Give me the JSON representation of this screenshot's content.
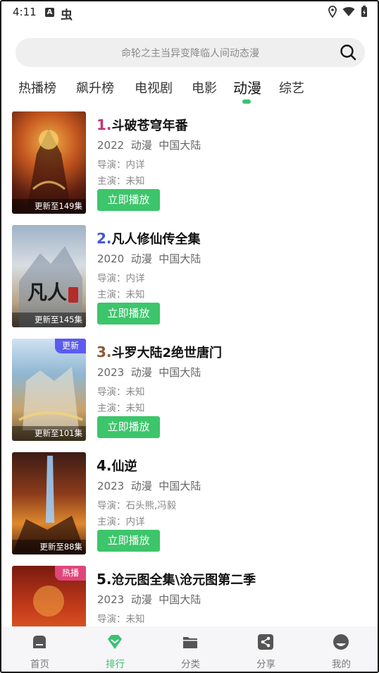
{
  "status_bar": {
    "time": "4:11",
    "a_glyph": "A",
    "bug_glyph": "虫"
  },
  "search": {
    "placeholder": "命轮之主当异变降临人间动态漫"
  },
  "tabs": [
    {
      "label": "热播榜"
    },
    {
      "label": "飙升榜"
    },
    {
      "label": "电视剧"
    },
    {
      "label": "电影"
    },
    {
      "label": "动漫",
      "active": true
    },
    {
      "label": "综艺"
    }
  ],
  "items": [
    {
      "rank": "1.",
      "rank_color": "#c2367a",
      "title": "斗破苍穹年番",
      "year": "2022",
      "type": "动漫",
      "region": "中国大陆",
      "director": "导演：内详",
      "actor": "主演：未知",
      "episodes": "更新至149集",
      "badge": "",
      "play_label": "立即播放"
    },
    {
      "rank": "2.",
      "rank_color": "#4457d6",
      "title": "凡人修仙传全集",
      "year": "2020",
      "type": "动漫",
      "region": "中国大陆",
      "director": "导演：内详",
      "actor": "主演：未知",
      "episodes": "更新至145集",
      "badge": "",
      "play_label": "立即播放"
    },
    {
      "rank": "3.",
      "rank_color": "#8a5a3a",
      "title": "斗罗大陆2绝世唐门",
      "year": "2023",
      "type": "动漫",
      "region": "中国大陆",
      "director": "导演：未知",
      "actor": "主演：未知",
      "episodes": "更新至101集",
      "badge": "更新",
      "badge_color": "#5b5bee",
      "play_label": "立即播放"
    },
    {
      "rank": "4.",
      "rank_color": "#111111",
      "title": "仙逆",
      "year": "2023",
      "type": "动漫",
      "region": "中国大陆",
      "director": "导演：石头熊,冯毅",
      "actor": "主演：内详",
      "episodes": "更新至88集",
      "badge": "",
      "play_label": "立即播放"
    },
    {
      "rank": "5.",
      "rank_color": "#111111",
      "title": "沧元图全集\\沧元图第二季",
      "year": "2023",
      "type": "动漫",
      "region": "中国大陆",
      "director": "导演：未知",
      "actor": "",
      "episodes": "",
      "badge": "热播",
      "badge_color": "#e0457a",
      "play_label": ""
    }
  ],
  "bottom_nav": [
    {
      "label": "首页",
      "icon": "home-icon"
    },
    {
      "label": "排行",
      "icon": "ranking-icon",
      "active": true
    },
    {
      "label": "分类",
      "icon": "folder-icon"
    },
    {
      "label": "分享",
      "icon": "share-icon"
    },
    {
      "label": "我的",
      "icon": "profile-icon"
    }
  ],
  "colors": {
    "accent": "#3ac270",
    "play_button": "#3cc56a"
  }
}
